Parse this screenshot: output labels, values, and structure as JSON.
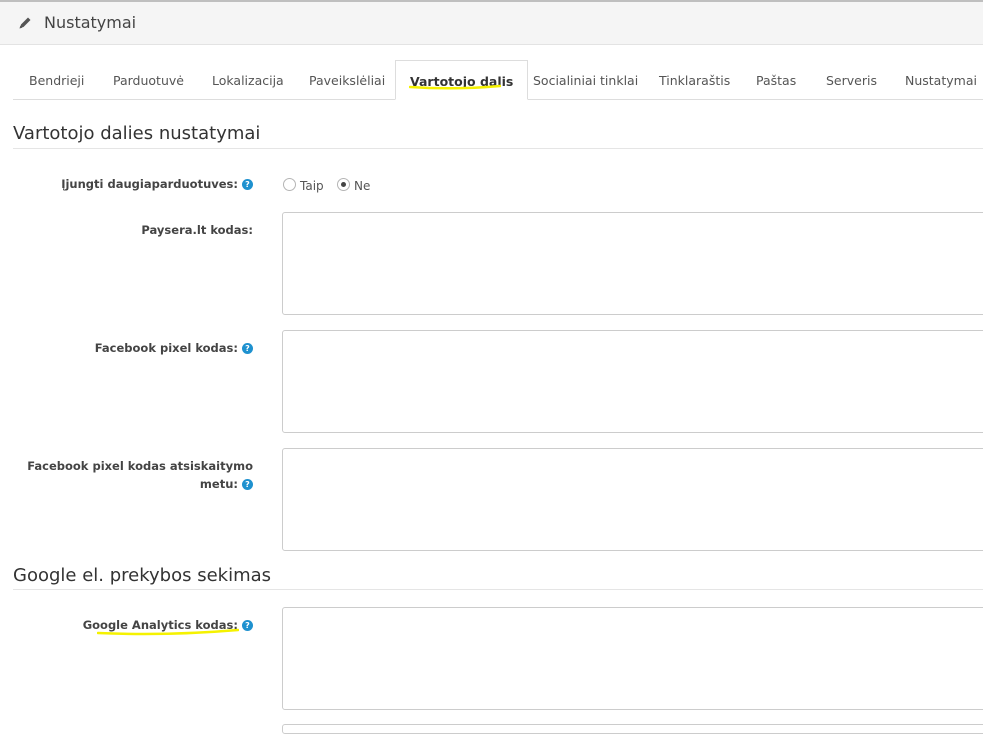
{
  "header": {
    "title": "Nustatymai",
    "icon": "pencil-icon"
  },
  "tabs": [
    {
      "label": "Bendrieji"
    },
    {
      "label": "Parduotuvė"
    },
    {
      "label": "Lokalizacija"
    },
    {
      "label": "Paveikslėliai"
    },
    {
      "label": "Vartotojo dalis",
      "active": true
    },
    {
      "label": "Socialiniai tinklai"
    },
    {
      "label": "Tinklaraštis"
    },
    {
      "label": "Paštas"
    },
    {
      "label": "Serveris"
    },
    {
      "label": "Nustatymai"
    }
  ],
  "section1": {
    "legend": "Vartotojo dalies nustatymai",
    "multistore": {
      "label": "Įjungti daugiaparduotuves:",
      "options": [
        "Taip",
        "Ne"
      ],
      "selected": "Ne"
    },
    "paysera": {
      "label": "Paysera.lt kodas:",
      "value": ""
    },
    "fb_pixel": {
      "label": "Facebook pixel kodas:",
      "value": ""
    },
    "fb_pixel_checkout": {
      "label_line1": "Facebook pixel kodas atsiskaitymo",
      "label_line2": "metu:",
      "value": ""
    }
  },
  "section2": {
    "legend": "Google el. prekybos sekimas",
    "ga": {
      "label": "Google Analytics kodas:",
      "value": ""
    }
  },
  "help_glyph": "?",
  "colors": {
    "help": "#1e91cf",
    "highlight": "#f5f200"
  }
}
